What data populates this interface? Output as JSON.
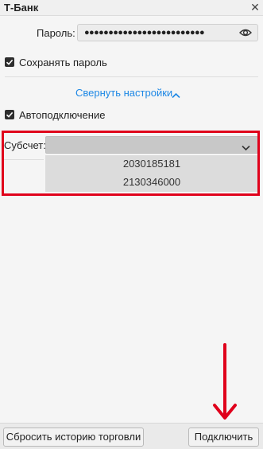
{
  "window": {
    "title": "Т-Банк",
    "close_glyph": "✕"
  },
  "password": {
    "label": "Пароль:",
    "value_masked": "●●●●●●●●●●●●●●●●●●●●●●●●●"
  },
  "save_password": {
    "label": "Сохранять пароль",
    "checked": true
  },
  "settings_toggle": {
    "label": "Свернуть настройки"
  },
  "autoconnect": {
    "label": "Автоподключение",
    "checked": true
  },
  "subaccount": {
    "label": "Субсчет:",
    "selected": "",
    "options": [
      "2030185181",
      "2130346000"
    ]
  },
  "buttons": {
    "reset_history": "Сбросить историю торговли",
    "connect": "Подключить"
  },
  "colors": {
    "accent": "#1e88e5",
    "highlight": "#e0001b"
  }
}
